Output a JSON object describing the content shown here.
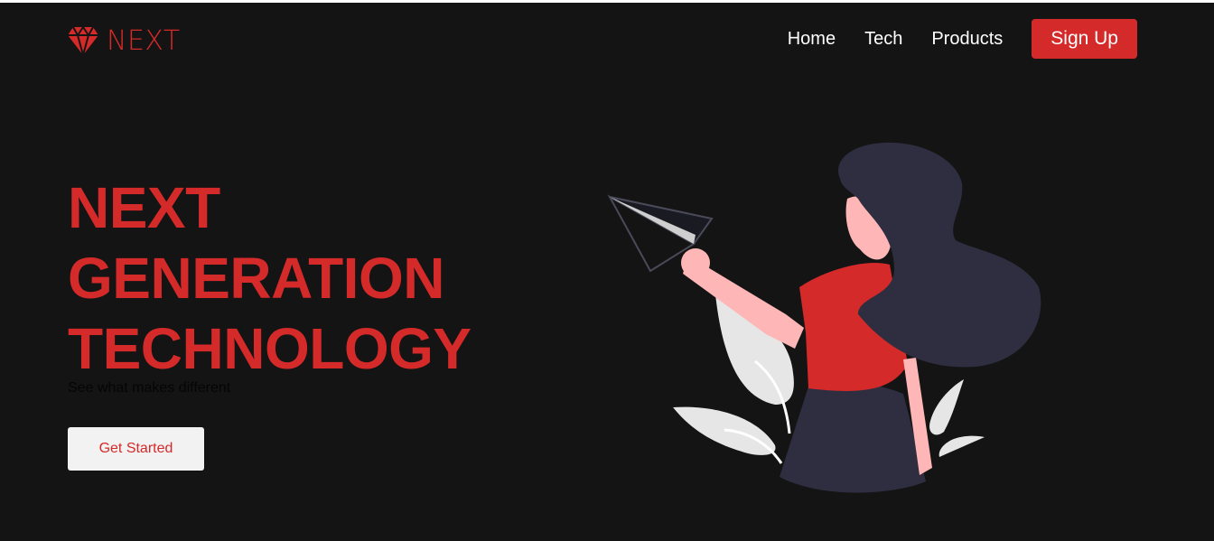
{
  "header": {
    "logo_text": "NEXT",
    "logo_icon": "diamond-icon",
    "nav": [
      "Home",
      "Tech",
      "Products"
    ],
    "signup_label": "Sign Up"
  },
  "hero": {
    "title_lines": [
      "NEXT",
      "GENERATION",
      "TECHNOLOGY"
    ],
    "subtitle": "See what makes different",
    "cta_label": "Get Started"
  },
  "colors": {
    "accent": "#d42a2a",
    "background": "#141414",
    "figure_dark": "#2f2e41",
    "skin": "#ffb6b6",
    "leaf": "#e6e6e6"
  }
}
